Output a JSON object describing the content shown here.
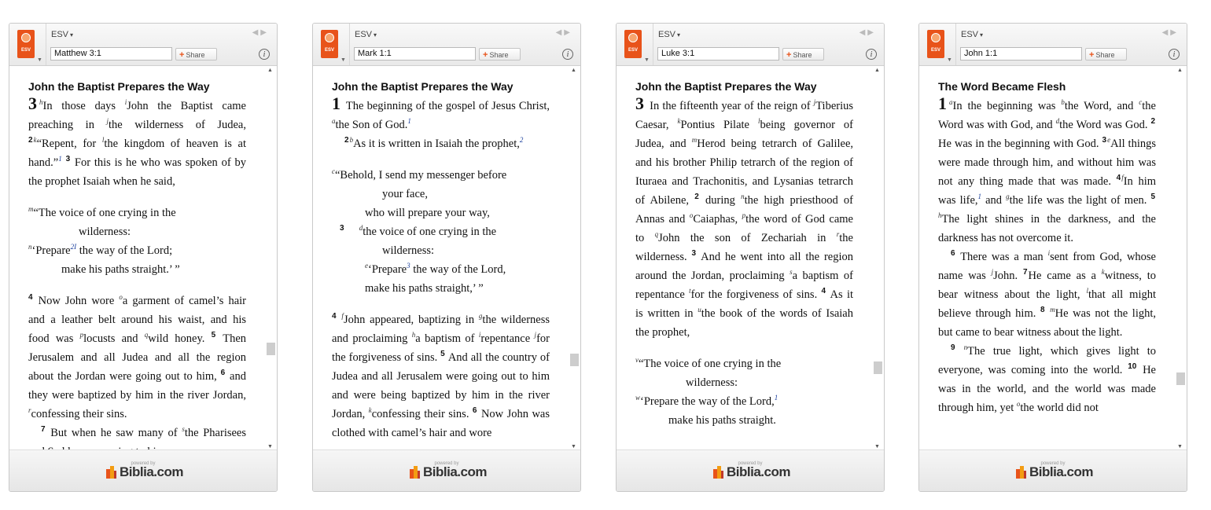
{
  "widgets": [
    {
      "logo_label": "ESV",
      "version": "ESV",
      "reference": "Matthew 3:1",
      "share_label": "Share",
      "info_label": "i",
      "heading": "John the Baptist Prepares the Way",
      "powered_by": "powered by",
      "brand": "Biblia.com"
    },
    {
      "logo_label": "ESV",
      "version": "ESV",
      "reference": "Mark 1:1",
      "share_label": "Share",
      "info_label": "i",
      "heading": "John the Baptist Prepares the Way",
      "powered_by": "powered by",
      "brand": "Biblia.com"
    },
    {
      "logo_label": "ESV",
      "version": "ESV",
      "reference": "Luke 3:1",
      "share_label": "Share",
      "info_label": "i",
      "heading": "John the Baptist Prepares the Way",
      "powered_by": "powered by",
      "brand": "Biblia.com"
    },
    {
      "logo_label": "ESV",
      "version": "ESV",
      "reference": "John 1:1",
      "share_label": "Share",
      "info_label": "i",
      "heading": "The Word Became Flesh",
      "powered_by": "powered by",
      "brand": "Biblia.com"
    }
  ],
  "texts": {
    "matt": {
      "chapter": "3",
      "a": "In those days ",
      "b": "John the Baptist came preaching in ",
      "c": "the wilderness of Judea,",
      "v2": "2",
      "d": "“Repent, for ",
      "e": "the kingdom of heaven is at hand.”",
      "v3": "3",
      "f": " For this is he who was spoken of by the prophet Isaiah when he said,",
      "p1": "“The voice of one crying in the",
      "p1b": "wilderness:",
      "p2": "‘Prepare",
      "p2b": " the way of the Lord;",
      "p3": "make his paths straight.’ ”",
      "v4": "4",
      "g": " Now John wore ",
      "h": "a garment of camel’s hair and a leather belt around his waist, and his food was ",
      "i": "locusts and ",
      "j": "wild honey.",
      "v5": "5",
      "k": " Then Jerusalem and all Judea and all the region about the Jordan were going out to him, ",
      "v6": "6",
      "l": " and they were baptized by him in the river Jordan, ",
      "m": "confessing their sins.",
      "v7": "7",
      "n": " But when he saw many of ",
      "o": "the Pharisees and Sadducees coming to his"
    },
    "mark": {
      "chapter": "1",
      "a": " The beginning of the gospel of Jesus Christ, ",
      "b": "the Son of God.",
      "v2": "2",
      "c": "As it is written in Isaiah the prophet,",
      "p1": "“Behold, I send my messenger before",
      "p1b": "your face,",
      "p2": "who will prepare your way,",
      "v3": "3",
      "p3": "the voice of one crying in the",
      "p3b": "wilderness:",
      "p4": "‘Prepare",
      "p4b": " the way of the Lord,",
      "p5": "make his paths straight,’ ”",
      "v4": "4",
      "d": "John appeared, baptizing in ",
      "e": "the wilderness and proclaiming ",
      "f": "a baptism of ",
      "g": "repentance ",
      "h": "for the forgiveness of sins.",
      "v5": "5",
      "i": " And all the country of Judea and all Jerusalem were going out to him and were being baptized by him in the river Jordan, ",
      "j": "confessing their sins.",
      "v6": "6",
      "k": " Now John was clothed with camel’s hair and wore"
    },
    "luke": {
      "chapter": "3",
      "a": " In the fifteenth year of the reign of ",
      "b": "Tiberius Caesar, ",
      "c": "Pontius Pilate ",
      "d": "being governor of Judea, and ",
      "e": "Herod being tetrarch of Galilee, and his brother Philip tetrarch of the region of Ituraea and Trachonitis, and Lysanias tetrarch of Abilene,",
      "v2": "2",
      "f": " during ",
      "g": "the high priesthood of Annas and ",
      "h": "Caiaphas, ",
      "i": "the word of God came to ",
      "j": "John the son of Zechariah in ",
      "k": "the wilderness.",
      "v3": "3",
      "l": " And he went into all the region around the Jordan, proclaiming ",
      "m": "a baptism of repentance ",
      "n": "for the forgiveness of sins.",
      "v4": "4",
      "o": " As it is written in ",
      "p": "the book of the words of Isaiah the prophet,",
      "p1": "“The voice of one crying in the",
      "p1b": "wilderness:",
      "p2": "‘Prepare the way of the Lord,",
      "p3": "make his paths straight."
    },
    "john": {
      "chapter": "1",
      "a": "In the beginning was ",
      "b": "the Word, and ",
      "c": "the Word was with God, and ",
      "d": "the Word was God.",
      "v2": "2",
      "e": " He was in the beginning with God.",
      "v3": "3",
      "f": "All things were made through him, and without him was not any thing made that was made.",
      "v4": "4",
      "g": "In him was life,",
      "h": " and ",
      "i": "the life was the light of men.",
      "v5": "5",
      "j": "The light shines in the darkness, and the darkness has not overcome it.",
      "v6": "6",
      "k": " There was a man ",
      "l": "sent from God, whose name was ",
      "m": "John.",
      "v7": "7",
      "n": "He came as a ",
      "o": "witness, to bear witness about the light, ",
      "p": "that all might believe through him.",
      "v8": "8",
      "q": "He was not the light, but came to bear witness about the light.",
      "v9": "9",
      "r": "The true light, which gives light to everyone, was coming into the world.",
      "v10": "10",
      "s": " He was in the world, and the world was made through him, yet ",
      "t": "the world did not"
    }
  },
  "colors": {
    "accent": "#e8531a",
    "footnote": "#1a3e9c"
  }
}
